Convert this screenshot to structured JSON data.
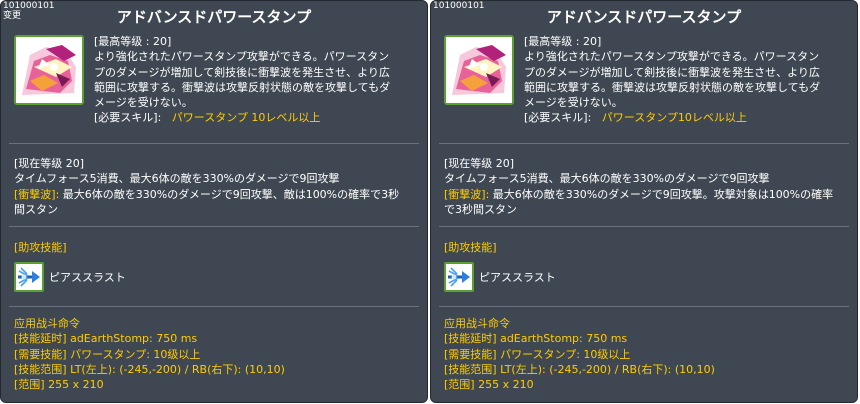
{
  "left": {
    "skill_id": "101000101",
    "change_tag": "变更",
    "title": "アドバンスドパワースタンプ",
    "desc_lines": [
      "[最高等级 : 20]",
      "より強化されたパワースタンプ攻撃ができる。パワースタン",
      "プのダメージが増加して剣技後に衝撃波を発生させ、より広",
      "範囲に攻撃する。衝撃波は攻撃反射状態の敵を攻撃してもダ",
      "メージを受けない。"
    ],
    "req_label": "[必要スキル]:",
    "req_value": "パワースタンプ 10レベル以上",
    "level_header": "[现在等级 20]",
    "level_line": "タイムフォース5消費、最大6体の敵を330%のダメージで9回攻撃",
    "shockwave_label": "[衝撃波]:",
    "shockwave_line1": "最大6体の敵を330%のダメージで9回攻撃、敵は100%の確率で3秒",
    "shockwave_line2": "間スタン",
    "assist_label": "[助攻技能]",
    "assist_skill_name": "ピアススラスト",
    "combat_title": "应用战斗命令",
    "combat_lines": [
      "[技能延时] adEarthStomp: 750 ms",
      "[需要技能] パワースタンプ: 10级以上",
      "[技能范围] LT(左上): (-245,-200) / RB(右下): (10,10)",
      "[范围] 255 x 210"
    ]
  },
  "right": {
    "skill_id": "101000101",
    "title": "アドバンスドパワースタンプ",
    "desc_lines": [
      "[最高等级 : 20]",
      "より強化されたパワースタンプ攻撃ができる。パワースタン",
      "プのダメージが増加して剣技後に衝撃波を発生させ、より広",
      "範囲に攻撃する。衝撃波は攻撃反射状態の敵を攻撃してもダ",
      "メージを受けない。"
    ],
    "req_label": "[必要スキル]:",
    "req_value": "パワースタンプ10レベル以上",
    "level_header": "[现在等级 20]",
    "level_line": "タイムフォース5消費、最大6体の敵を330%のダメージで9回攻撃",
    "shockwave_label": "[衝撃波]:",
    "shockwave_line1": "最大6体の敵を330%のダメージで9回攻撃。攻撃対象は100%の確率",
    "shockwave_line2": "で3秒間スタン",
    "assist_label": "[助攻技能]",
    "assist_skill_name": "ピアススラスト",
    "combat_title": "应用战斗命令",
    "combat_lines": [
      "[技能延时] adEarthStomp: 750 ms",
      "[需要技能] パワースタンプ: 10级以上",
      "[技能范围] LT(左上): (-245,-200) / RB(右下): (10,10)",
      "[范围] 255 x 210"
    ]
  },
  "icons": {
    "main": "power-stamp-icon",
    "assist": "pierce-thrust-icon"
  },
  "colors": {
    "panel_bg": "#3f4852",
    "highlight": "#ffcc00",
    "icon_border": "#5aa032"
  }
}
